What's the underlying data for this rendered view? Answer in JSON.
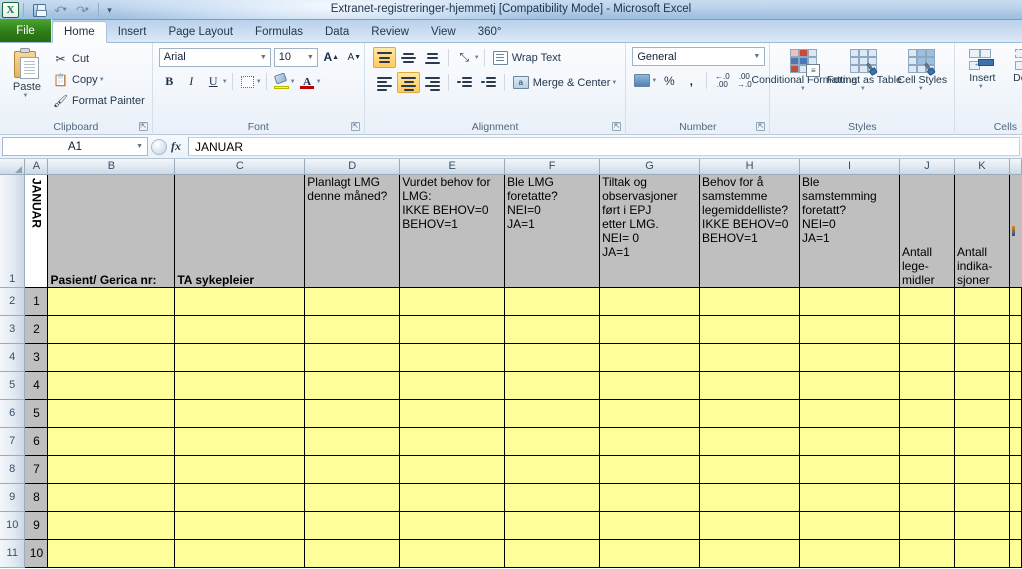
{
  "window": {
    "title": "Extranet-registreringer-hjemmetj  [Compatibility Mode]  -  Microsoft Excel",
    "quick_access": [
      {
        "name": "excel-logo",
        "glyph": "X"
      },
      {
        "name": "save",
        "glyph": "save"
      },
      {
        "name": "undo",
        "glyph": "undo"
      },
      {
        "name": "redo",
        "glyph": "redo"
      },
      {
        "name": "customize-qat",
        "glyph": "caret"
      }
    ]
  },
  "ribbon": {
    "tabs": [
      {
        "label": "File",
        "active": false
      },
      {
        "label": "Home",
        "active": true
      },
      {
        "label": "Insert",
        "active": false
      },
      {
        "label": "Page Layout",
        "active": false
      },
      {
        "label": "Formulas",
        "active": false
      },
      {
        "label": "Data",
        "active": false
      },
      {
        "label": "Review",
        "active": false
      },
      {
        "label": "View",
        "active": false
      },
      {
        "label": "360°",
        "active": false
      }
    ],
    "clipboard": {
      "group_label": "Clipboard",
      "paste_label": "Paste",
      "cut_label": "Cut",
      "copy_label": "Copy",
      "format_painter_label": "Format Painter"
    },
    "font": {
      "group_label": "Font",
      "font_name": "Arial",
      "font_size": "10",
      "grow_label": "A",
      "shrink_label": "A",
      "bold_label": "B",
      "italic_label": "I",
      "underline_label": "U",
      "fill_color": "#ffff00",
      "font_color": "#c00000"
    },
    "alignment": {
      "group_label": "Alignment",
      "wrap_text_label": "Wrap Text",
      "merge_center_label": "Merge & Center",
      "active_vertical": "top-align",
      "active_horizontal": "center-align"
    },
    "number": {
      "group_label": "Number",
      "format": "General",
      "percent_label": "%",
      "comma_label": ",",
      "increase_decimal_label": ".00",
      "decrease_decimal_label": ".00"
    },
    "styles": {
      "group_label": "Styles",
      "conditional_formatting_label": "Conditional\nFormatting",
      "format_as_table_label": "Format\nas Table",
      "cell_styles_label": "Cell\nStyles"
    },
    "cells": {
      "group_label": "Cells",
      "insert_label": "Insert",
      "delete_label": "Delete"
    }
  },
  "formula_bar": {
    "name_box": "A1",
    "fx_label": "fx",
    "content": "JANUAR"
  },
  "sheet": {
    "column_headers": [
      "A",
      "B",
      "C",
      "D",
      "E",
      "F",
      "G",
      "H",
      "I",
      "J",
      "K"
    ],
    "row_headers": [
      "1",
      "2",
      "3",
      "4",
      "5",
      "6",
      "7",
      "8",
      "9",
      "10",
      "11"
    ],
    "header_row": {
      "A": "JANUAR",
      "B": "Pasient/ Gerica nr:",
      "C": "TA sykepleier",
      "D": "Planlagt LMG\ndenne måned?",
      "E": "Vurdet behov for\nLMG:\nIKKE BEHOV=0\nBEHOV=1",
      "F": "Ble LMG\nforetatte?\nNEI=0\nJA=1",
      "G": "Tiltak og\nobservasjoner\nført i EPJ\netter LMG.\nNEI= 0\nJA=1",
      "H": "Behov for å\nsamstemme\nlegemiddelliste?\nIKKE BEHOV=0\nBEHOV=1",
      "I": "Ble\nsamstemming\nforetatt?\nNEI=0\nJA=1",
      "J": "Antall\nlege-\nmidler",
      "K": "Antall\nindika-\nsjoner"
    },
    "data_rows": [
      {
        "row": "2",
        "counter": "1"
      },
      {
        "row": "3",
        "counter": "2"
      },
      {
        "row": "4",
        "counter": "3"
      },
      {
        "row": "5",
        "counter": "4"
      },
      {
        "row": "6",
        "counter": "5"
      },
      {
        "row": "7",
        "counter": "6"
      },
      {
        "row": "8",
        "counter": "7"
      },
      {
        "row": "9",
        "counter": "8"
      },
      {
        "row": "10",
        "counter": "9"
      },
      {
        "row": "11",
        "counter": "10"
      }
    ],
    "cell_fill_empty": "#ffff99",
    "cell_fill_header": "#bfbfbf"
  }
}
